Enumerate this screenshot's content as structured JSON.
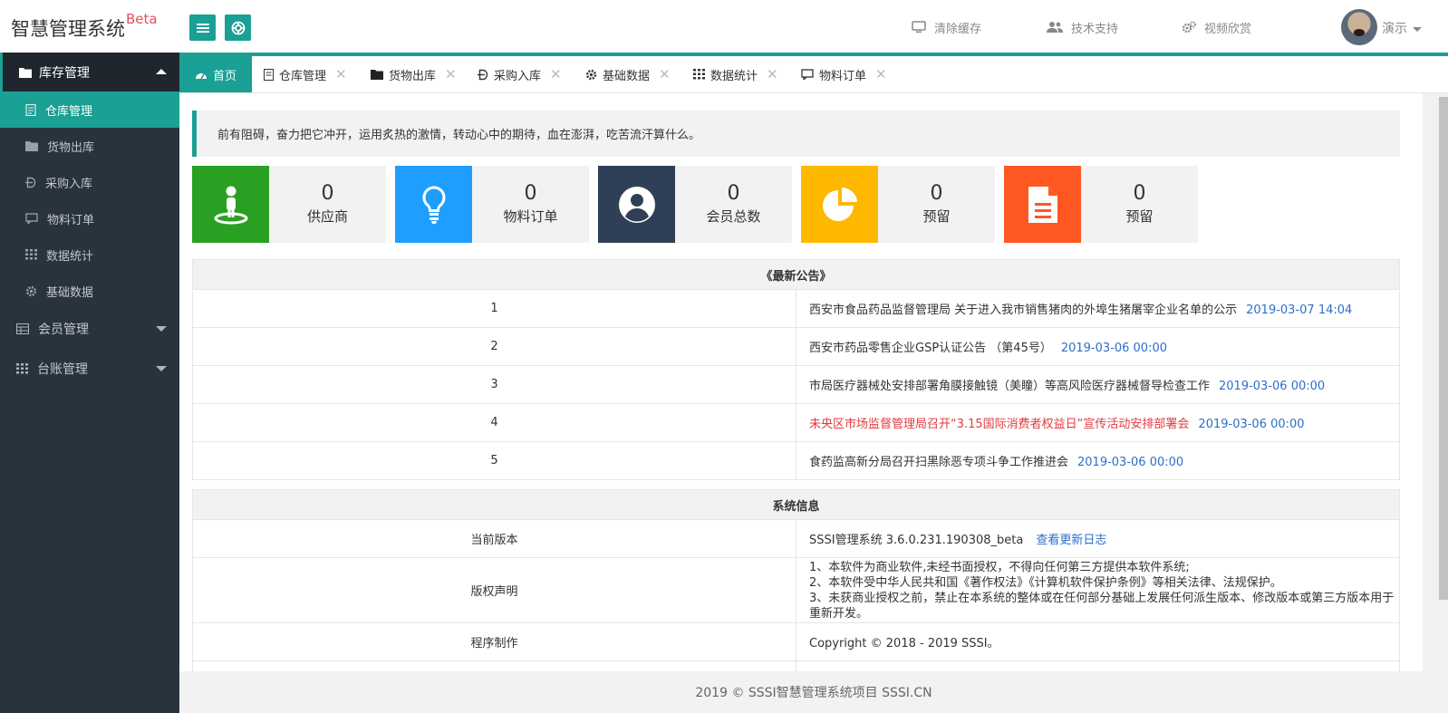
{
  "header": {
    "logo": "智慧管理系统",
    "logo_badge": "Beta",
    "menu": [
      {
        "label": "清除缓存",
        "icon": "monitor-icon"
      },
      {
        "label": "技术支持",
        "icon": "users-icon"
      },
      {
        "label": "视频欣赏",
        "icon": "gears-icon"
      }
    ],
    "user": "演示"
  },
  "sidebar": {
    "head": "库存管理",
    "items": [
      {
        "label": "仓库管理",
        "active": true
      },
      {
        "label": "货物出库"
      },
      {
        "label": "采购入库"
      },
      {
        "label": "物料订单"
      },
      {
        "label": "数据统计"
      },
      {
        "label": "基础数据"
      }
    ],
    "groups": [
      "会员管理",
      "台账管理"
    ]
  },
  "tabs": [
    {
      "label": "首页"
    },
    {
      "label": "仓库管理"
    },
    {
      "label": "货物出库"
    },
    {
      "label": "采购入库"
    },
    {
      "label": "基础数据"
    },
    {
      "label": "数据统计"
    },
    {
      "label": "物料订单"
    }
  ],
  "tab_close": "✕",
  "notice": "前有阻碍，奋力把它冲开，运用炙热的激情，转动心中的期待，血在澎湃，吃苦流汗算什么。",
  "cards": [
    {
      "value": "0",
      "label": "供应商",
      "color": "#2aa022"
    },
    {
      "value": "0",
      "label": "物料订单",
      "color": "#1e9fff"
    },
    {
      "value": "0",
      "label": "会员总数",
      "color": "#2f4056"
    },
    {
      "value": "0",
      "label": "预留",
      "color": "#ffb800"
    },
    {
      "value": "0",
      "label": "预留",
      "color": "#ff5722"
    }
  ],
  "announcements": {
    "title": "《最新公告》",
    "rows": [
      {
        "no": "1",
        "text": "西安市食品药品监督管理局 关于进入我市销售猪肉的外埠生猪屠宰企业名单的公示",
        "date": "2019-03-07 14:04"
      },
      {
        "no": "2",
        "text": "西安市药品零售企业GSP认证公告 （第45号）",
        "date": "2019-03-06 00:00"
      },
      {
        "no": "3",
        "text": "市局医疗器械处安排部署角膜接触镜（美瞳）等高风险医疗器械督导检查工作",
        "date": "2019-03-06 00:00"
      },
      {
        "no": "4",
        "text": "未央区市场监督管理局召开“3.15国际消费者权益日”宣传活动安排部署会",
        "date": "2019-03-06 00:00",
        "red": true
      },
      {
        "no": "5",
        "text": "食药监高新分局召开扫黑除恶专项斗争工作推进会",
        "date": "2019-03-06 00:00"
      }
    ]
  },
  "sysinfo": {
    "title": "系统信息",
    "version_label": "当前版本",
    "version": "SSSI管理系统 3.6.0.231.190308_beta",
    "changelog": "查看更新日志",
    "copyright_label": "版权声明",
    "copyright_lines": [
      "1、本软件为商业软件,未经书面授权，不得向任何第三方提供本软件系统;",
      "2、本软件受中华人民共和国《著作权法》《计算机软件保护条例》等相关法律、法规保护。",
      "3、未获商业授权之前，禁止在本系统的整体或在任何部分基础上发展任何派生版本、修改版本或第三方版本用于重新开发。"
    ],
    "maker_label": "程序制作",
    "maker": "Copyright © 2018 - 2019 SSSI。"
  },
  "footer": "2019 ©  SSSI智慧管理系统项目  SSSI.CN"
}
